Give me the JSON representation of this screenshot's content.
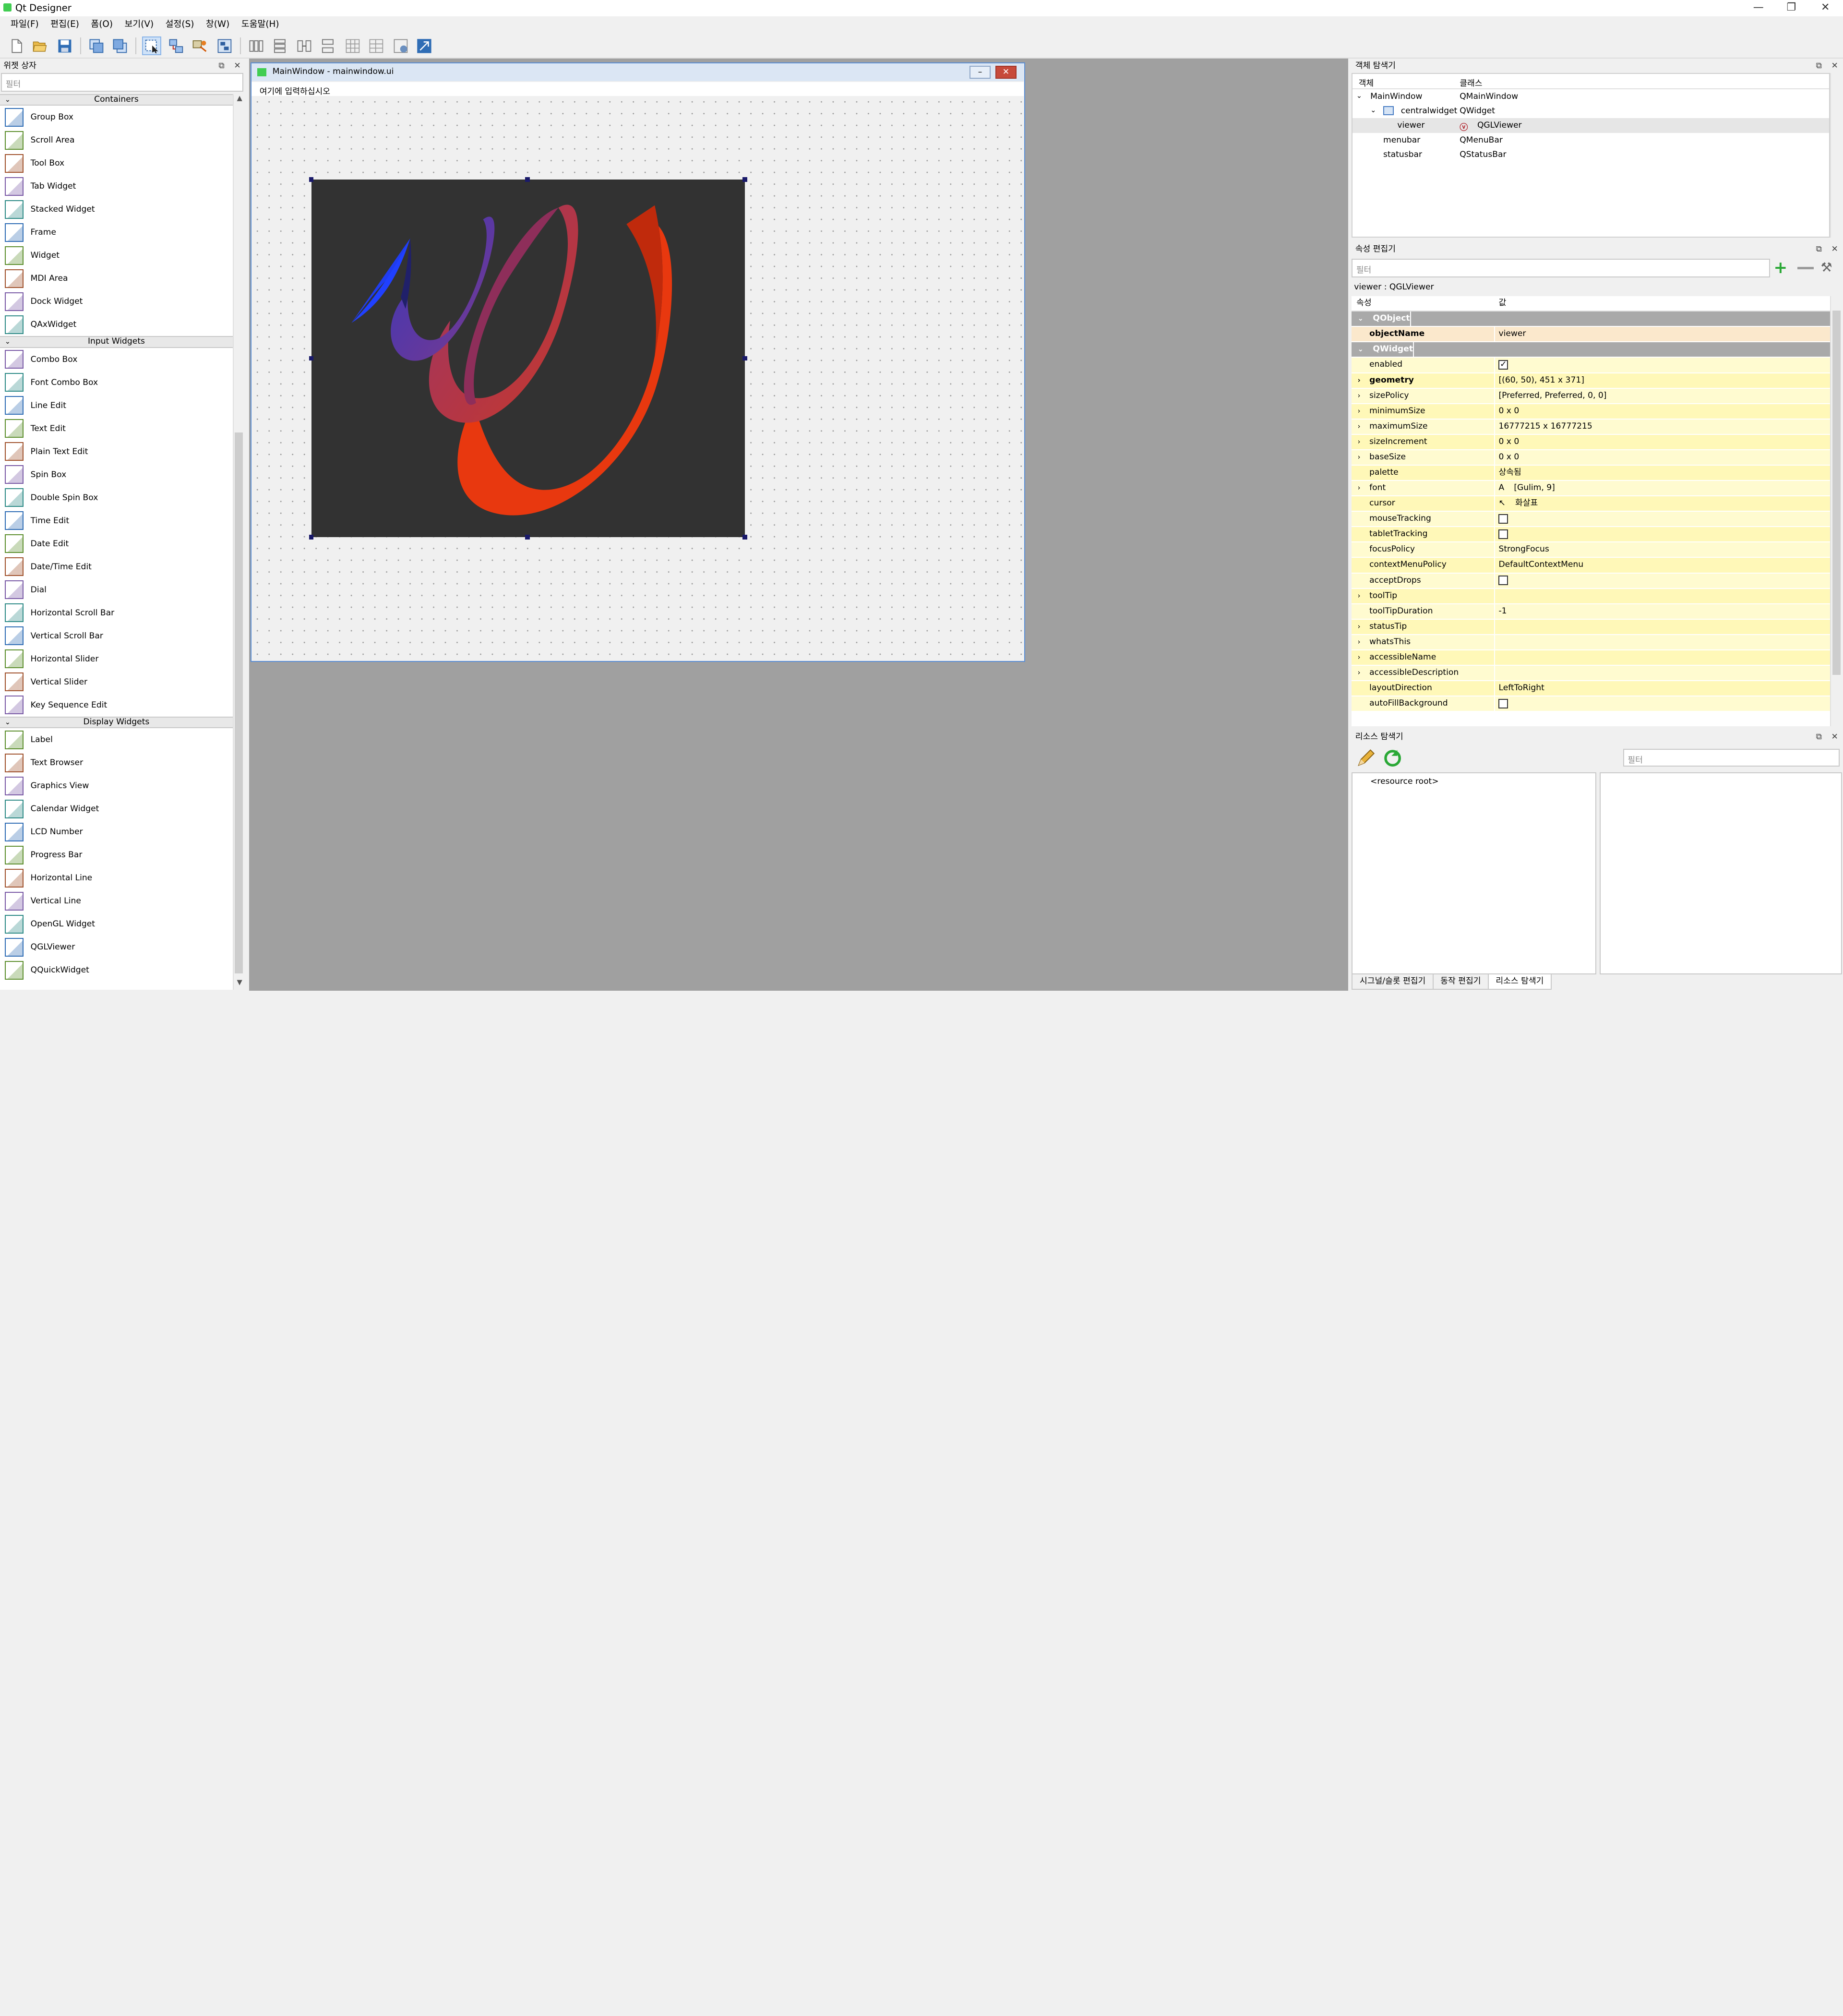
{
  "window": {
    "title": "Qt Designer",
    "min": "—",
    "restore": "❐",
    "close": "✕"
  },
  "menu": [
    "파일(F)",
    "편집(E)",
    "폼(O)",
    "보기(V)",
    "설정(S)",
    "창(W)",
    "도움말(H)"
  ],
  "widget_box": {
    "title": "위젯 상자",
    "filter_placeholder": "필터",
    "categories": [
      {
        "name": "Containers",
        "items": [
          "Group Box",
          "Scroll Area",
          "Tool Box",
          "Tab Widget",
          "Stacked Widget",
          "Frame",
          "Widget",
          "MDI Area",
          "Dock Widget",
          "QAxWidget"
        ]
      },
      {
        "name": "Input Widgets",
        "items": [
          "Combo Box",
          "Font Combo Box",
          "Line Edit",
          "Text Edit",
          "Plain Text Edit",
          "Spin Box",
          "Double Spin Box",
          "Time Edit",
          "Date Edit",
          "Date/Time Edit",
          "Dial",
          "Horizontal Scroll Bar",
          "Vertical Scroll Bar",
          "Horizontal Slider",
          "Vertical Slider",
          "Key Sequence Edit"
        ]
      },
      {
        "name": "Display Widgets",
        "items": [
          "Label",
          "Text Browser",
          "Graphics View",
          "Calendar Widget",
          "LCD Number",
          "Progress Bar",
          "Horizontal Line",
          "Vertical Line",
          "OpenGL Widget",
          "QGLViewer",
          "QQuickWidget"
        ]
      }
    ]
  },
  "form": {
    "title": "MainWindow - mainwindow.ui",
    "menu_placeholder": "여기에 입력하십시오",
    "min_btn": "–",
    "close_btn": "✕"
  },
  "object_inspector": {
    "title": "객체 탐색기",
    "col_object": "객체",
    "col_class": "클래스",
    "rows": [
      {
        "object": "MainWindow",
        "class": "QMainWindow"
      },
      {
        "object": "centralwidget",
        "class": "QWidget"
      },
      {
        "object": "viewer",
        "class": "QGLViewer"
      },
      {
        "object": "menubar",
        "class": "QMenuBar"
      },
      {
        "object": "statusbar",
        "class": "QStatusBar"
      }
    ]
  },
  "property_editor": {
    "title": "속성 편집기",
    "filter_placeholder": "필터",
    "subtitle": "viewer : QGLViewer",
    "col_property": "속성",
    "col_value": "값",
    "group_qobject": "QObject",
    "object_name_label": "objectName",
    "object_name_value": "viewer",
    "group_qwidget": "QWidget",
    "props": [
      {
        "name": "enabled",
        "value": "",
        "check": "on"
      },
      {
        "name": "geometry",
        "value": "[(60, 50), 451 x 371]",
        "bold": true,
        "expand": true
      },
      {
        "name": "sizePolicy",
        "value": "[Preferred, Preferred, 0, 0]",
        "expand": true
      },
      {
        "name": "minimumSize",
        "value": "0 x 0",
        "expand": true
      },
      {
        "name": "maximumSize",
        "value": "16777215 x 16777215",
        "expand": true
      },
      {
        "name": "sizeIncrement",
        "value": "0 x 0",
        "expand": true
      },
      {
        "name": "baseSize",
        "value": "0 x 0",
        "expand": true
      },
      {
        "name": "palette",
        "value": "상속됨"
      },
      {
        "name": "font",
        "value": "[Gulim, 9]",
        "expand": true,
        "glyph": "A"
      },
      {
        "name": "cursor",
        "value": "화살표",
        "glyph": "↖"
      },
      {
        "name": "mouseTracking",
        "value": "",
        "check": "off"
      },
      {
        "name": "tabletTracking",
        "value": "",
        "check": "off"
      },
      {
        "name": "focusPolicy",
        "value": "StrongFocus"
      },
      {
        "name": "contextMenuPolicy",
        "value": "DefaultContextMenu"
      },
      {
        "name": "acceptDrops",
        "value": "",
        "check": "off"
      },
      {
        "name": "toolTip",
        "value": "",
        "expand": true
      },
      {
        "name": "toolTipDuration",
        "value": "-1"
      },
      {
        "name": "statusTip",
        "value": "",
        "expand": true
      },
      {
        "name": "whatsThis",
        "value": "",
        "expand": true
      },
      {
        "name": "accessibleName",
        "value": "",
        "expand": true
      },
      {
        "name": "accessibleDescription",
        "value": "",
        "expand": true
      },
      {
        "name": "layoutDirection",
        "value": "LeftToRight"
      },
      {
        "name": "autoFillBackground",
        "value": "",
        "check": "off"
      }
    ]
  },
  "resource_browser": {
    "title": "리소스 탐색기",
    "filter_placeholder": "필터",
    "root": "<resource root>",
    "tabs": [
      "시그널/슬롯 편집기",
      "동작 편집기",
      "리소스 탐색기"
    ]
  }
}
